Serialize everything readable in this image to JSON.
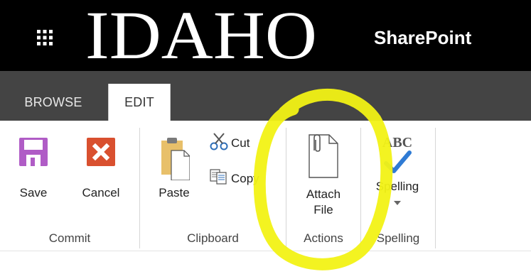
{
  "suite_bar": {
    "logo_text": "IDAHO",
    "brand_label": "SharePoint"
  },
  "tabs": [
    {
      "label": "BROWSE",
      "selected": false
    },
    {
      "label": "EDIT",
      "selected": true
    }
  ],
  "ribbon": {
    "groups": {
      "commit": {
        "label": "Commit",
        "save_label": "Save",
        "cancel_label": "Cancel"
      },
      "clipboard": {
        "label": "Clipboard",
        "paste_label": "Paste",
        "cut_label": "Cut",
        "copy_label": "Copy"
      },
      "actions": {
        "label": "Actions",
        "attach_line1": "Attach",
        "attach_line2": "File"
      },
      "spelling": {
        "label": "Spelling",
        "abc_label": "ABC",
        "spelling_label": "Spelling"
      }
    }
  },
  "colors": {
    "suite_bar": "#000000",
    "tab_row": "#444444",
    "save_icon": "#b05cc6",
    "cancel_icon": "#d9502f",
    "paste_icon": "#e8c06a",
    "spelling_check": "#2f7bd4",
    "annotation": "#f2f215"
  },
  "icons": [
    "waffle-icon",
    "save-icon",
    "cancel-icon",
    "paste-icon",
    "scissors-icon",
    "copy-icon",
    "attach-file-icon",
    "spell-check-icon",
    "dropdown-arrow-icon"
  ]
}
